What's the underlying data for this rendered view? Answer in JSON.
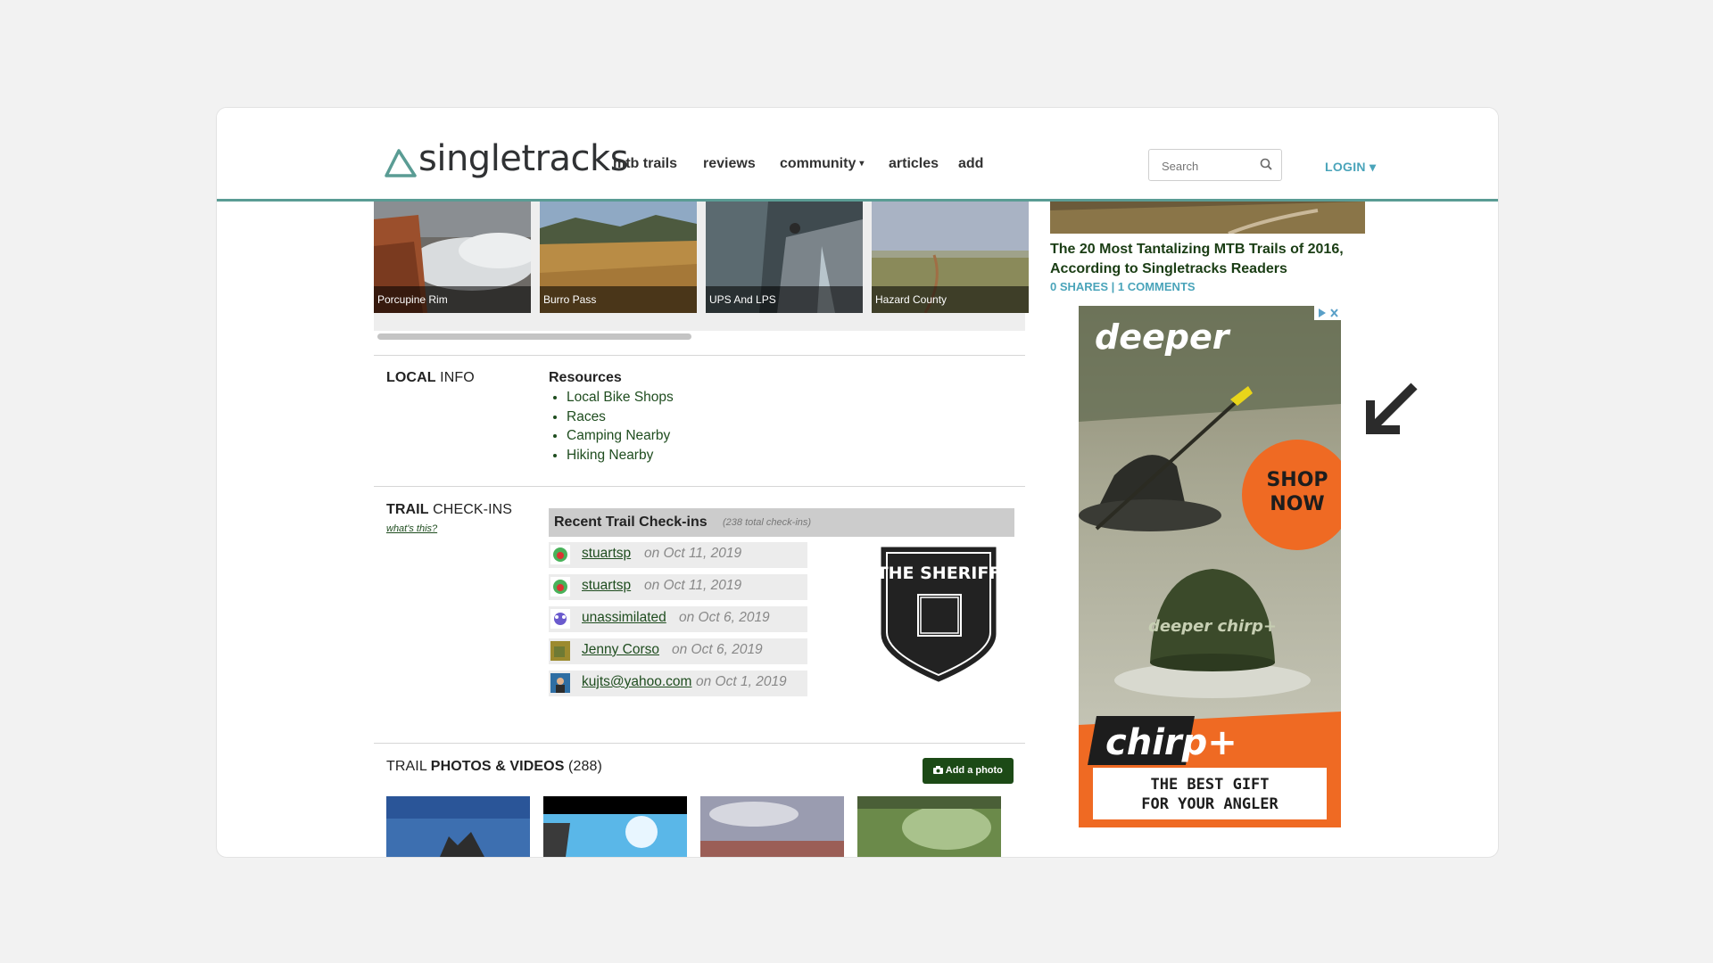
{
  "header": {
    "logo_text": "singletracks",
    "nav": [
      {
        "label": "mtb trails"
      },
      {
        "label": "reviews"
      },
      {
        "label": "community"
      },
      {
        "label": "articles"
      },
      {
        "label": "add"
      }
    ],
    "community_caret": "▾",
    "search_placeholder": "Search",
    "login_label": "LOGIN ▾"
  },
  "colors": {
    "accent_teal": "#5a9c94",
    "link_blue": "#4aa4ba",
    "link_green": "#1f4d1f",
    "button_green": "#1c4a16"
  },
  "nearby_trails": [
    {
      "name": "Porcupine Rim"
    },
    {
      "name": "Burro Pass"
    },
    {
      "name": "UPS And LPS"
    },
    {
      "name": "Hazard County"
    }
  ],
  "local_info": {
    "title_bold": "LOCAL",
    "title_rest": " INFO",
    "resources_heading": "Resources",
    "links": [
      "Local Bike Shops",
      "Races",
      "Camping Nearby",
      "Hiking Nearby"
    ]
  },
  "checkins": {
    "title_bold": "TRAIL",
    "title_rest": " CHECK-INS",
    "whats_this": "what's this?",
    "header": "Recent Trail Check-ins",
    "total": "(238 total check-ins)",
    "rows": [
      {
        "user": "stuartsp",
        "date": "on Oct 11, 2019"
      },
      {
        "user": "stuartsp",
        "date": "on Oct 11, 2019"
      },
      {
        "user": "unassimilated",
        "date": "on Oct 6, 2019"
      },
      {
        "user": "Jenny Corso",
        "date": "on Oct 6, 2019"
      },
      {
        "user": "kujts@yahoo.com",
        "date": "on Oct 1, 2019"
      }
    ],
    "badge_text": "THE SHERIFF"
  },
  "photos": {
    "title_pre": "TRAIL ",
    "title_bold": "PHOTOS & VIDEOS",
    "count": " (288)",
    "add_button": "Add a photo"
  },
  "sidebar": {
    "article_title": "The 20 Most Tantalizing MTB Trails of 2016, According to Singletracks Readers",
    "article_meta": "0 SHARES | 1 COMMENTS"
  },
  "ad": {
    "brand": "deeper",
    "cta": "SHOP NOW",
    "product": "chirp+",
    "device_label": "deeper chirp+",
    "tagline_line1": "THE BEST GIFT",
    "tagline_line2": "FOR YOUR ANGLER"
  }
}
